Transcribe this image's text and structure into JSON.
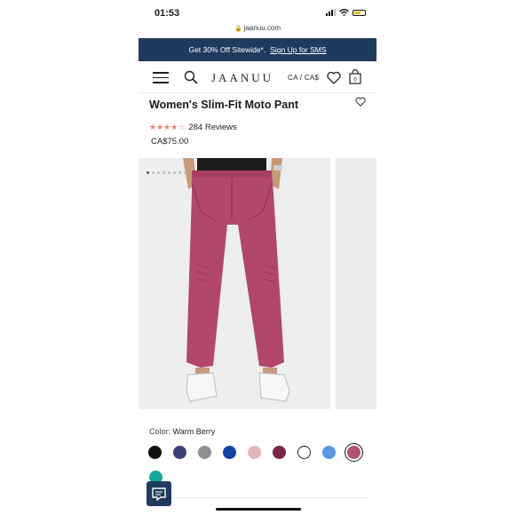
{
  "status": {
    "time": "01:53",
    "url": "jaanuu.com"
  },
  "promo": {
    "text": "Get 30% Off Sitewide*.",
    "link": "Sign Up for SMS"
  },
  "header": {
    "logo": "JAANUU",
    "locale": "CA / CA$"
  },
  "product": {
    "title": "Women's Slim-Fit Moto Pant",
    "stars": "★★★★☆",
    "reviews": "284 Reviews",
    "price": "CA$75.00",
    "rating_value": 4.5
  },
  "gallery": {
    "image_count": 8,
    "active_index": 0
  },
  "color": {
    "label": "Color:",
    "selected_name": "Warm Berry",
    "swatches": [
      "#111111",
      "#3b3f7a",
      "#8e8e8e",
      "#1541a0",
      "#e3b6b8",
      "#7a2446",
      "#ffffff",
      "#5b97e4",
      "#b0526f",
      "#15a89a"
    ],
    "selected_index": 8
  }
}
